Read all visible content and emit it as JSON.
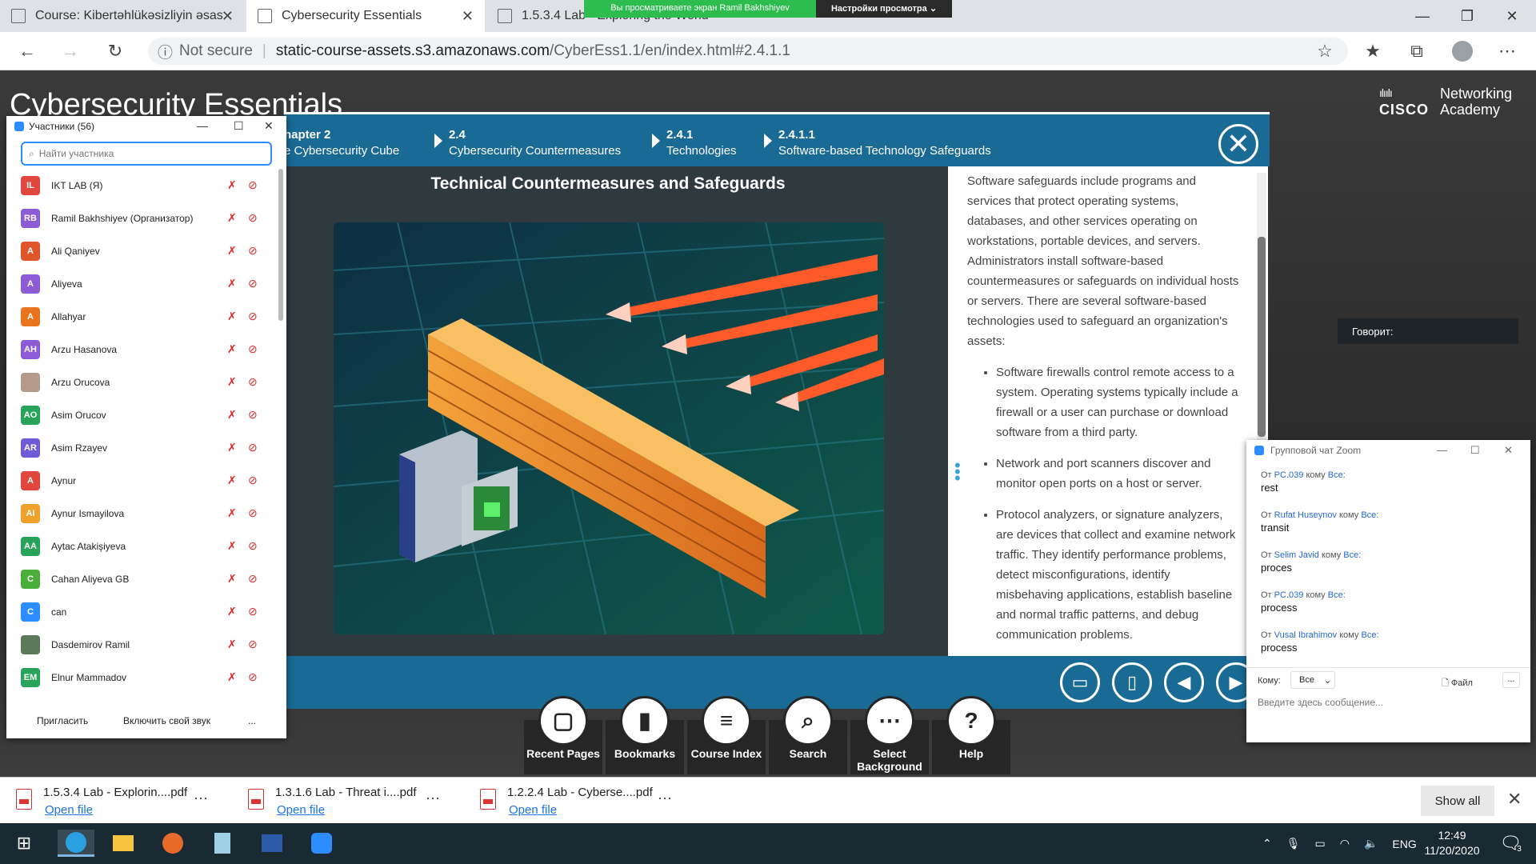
{
  "browser": {
    "tabs": [
      {
        "title": "Course: Kibertəhlükəsizliyin əsas"
      },
      {
        "title": "Cybersecurity Essentials"
      },
      {
        "title": "1.5.3.4 Lab - Exploring the World"
      }
    ],
    "share_banner": {
      "text": "Вы просматриваете экран Ramil Bakhshiyev",
      "options": "Настройки просмотра ⌄"
    },
    "address": {
      "security": "Not secure",
      "host": "static-course-assets.s3.amazonaws.com",
      "path": "/CyberEss1.1/en/index.html#2.4.1.1"
    }
  },
  "course": {
    "title": "Cybersecurity Essentials",
    "brand_line1": "Networking",
    "brand_line2": "Academy",
    "brand_mark": "CISCO",
    "breadcrumbs": [
      {
        "num": "hapter 2",
        "label": "e Cybersecurity Cube"
      },
      {
        "num": "2.4",
        "label": "Cybersecurity Countermeasures"
      },
      {
        "num": "2.4.1",
        "label": "Technologies"
      },
      {
        "num": "2.4.1.1",
        "label": "Software-based Technology Safeguards"
      }
    ],
    "heading": "Technical Countermeasures and Safeguards",
    "intro": "Software safeguards include programs and services that protect operating systems, databases, and other services operating on workstations, portable devices, and servers. Administrators install software-based countermeasures or safeguards on individual hosts or servers. There are several software-based technologies used to safeguard an organization's assets:",
    "bullets": [
      "Software firewalls control remote access to a system. Operating systems typically include a firewall or a user can purchase or download software from a third party.",
      "Network and port scanners discover and monitor open ports on a host or server.",
      "Protocol analyzers, or signature analyzers, are devices that collect and examine network traffic. They identify performance problems, detect misconfigurations, identify misbehaving applications, establish baseline and normal traffic patterns, and debug communication problems."
    ],
    "tools": [
      {
        "label": "Recent Pages",
        "icon": "recent-pages-icon"
      },
      {
        "label": "Bookmarks",
        "icon": "bookmark-icon"
      },
      {
        "label": "Course Index",
        "icon": "list-icon"
      },
      {
        "label": "Search",
        "icon": "search-icon"
      },
      {
        "label": "Select Background",
        "icon": "grid-icon"
      },
      {
        "label": "Help",
        "icon": "help-icon"
      }
    ]
  },
  "participants": {
    "title": "Участники (56)",
    "search_placeholder": "Найти участника",
    "list": [
      {
        "initials": "IL",
        "name": "IKT LAB (Я)",
        "color": "#e0463b"
      },
      {
        "initials": "RB",
        "name": "Ramil Bakhshiyev (Организатор)",
        "color": "#8e5bd6"
      },
      {
        "initials": "A",
        "name": "Ali Qaniyev",
        "color": "#e0562b"
      },
      {
        "initials": "A",
        "name": "Aliyeva",
        "color": "#8e5bd6"
      },
      {
        "initials": "A",
        "name": "Allahyar",
        "color": "#e8741e"
      },
      {
        "initials": "AH",
        "name": "Arzu Hasanova",
        "color": "#8e5bd6"
      },
      {
        "initials": "",
        "name": "Arzu Orucova",
        "color": "#b59a8a"
      },
      {
        "initials": "AO",
        "name": "Asim Orucov",
        "color": "#27a35a"
      },
      {
        "initials": "AR",
        "name": "Asim Rzayev",
        "color": "#6e5bd6"
      },
      {
        "initials": "A",
        "name": "Aynur",
        "color": "#e0463b"
      },
      {
        "initials": "AI",
        "name": "Aynur Ismayilova",
        "color": "#f0a12b"
      },
      {
        "initials": "AA",
        "name": "Aytac Atakişiyeva",
        "color": "#27a35a"
      },
      {
        "initials": "C",
        "name": "Cahan Aliyeva GB",
        "color": "#4cae3a"
      },
      {
        "initials": "C",
        "name": "can",
        "color": "#2d8cff"
      },
      {
        "initials": "",
        "name": "Dasdemirov Ramil",
        "color": "#5a7a5a"
      },
      {
        "initials": "EM",
        "name": "Elnur Mammadov",
        "color": "#27a35a"
      }
    ],
    "footer": {
      "invite": "Пригласить",
      "unmute": "Включить свой звук",
      "more": "..."
    }
  },
  "speaking": {
    "label": "Говорит:"
  },
  "chat": {
    "title": "Групповой чат Zoom",
    "messages": [
      {
        "from": "PC.039",
        "to": "Все:",
        "text": "rest"
      },
      {
        "from": "Rufat Huseynov",
        "to": "Все:",
        "text": "transit"
      },
      {
        "from": "Selim Javid",
        "to": "Все:",
        "text": "proces"
      },
      {
        "from": "PC.039",
        "to": "Все:",
        "text": "process"
      },
      {
        "from": "Vusal Ibrahimov",
        "to": "Все:",
        "text": "process"
      }
    ],
    "from_word": "От",
    "to_word": "кому",
    "to_label": "Кому:",
    "to_value": "Все",
    "file_label": "Файл",
    "more": "...",
    "input_placeholder": "Введите здесь сообщение..."
  },
  "downloads": {
    "items": [
      {
        "name": "1.5.3.4 Lab - Explorin....pdf",
        "action": "Open file"
      },
      {
        "name": "1.3.1.6 Lab - Threat i....pdf",
        "action": "Open file"
      },
      {
        "name": "1.2.2.4 Lab - Cyberse....pdf",
        "action": "Open file"
      }
    ],
    "show_all": "Show all"
  },
  "taskbar": {
    "lang": "ENG",
    "time": "12:49",
    "date": "11/20/2020",
    "notif_count": "3"
  }
}
